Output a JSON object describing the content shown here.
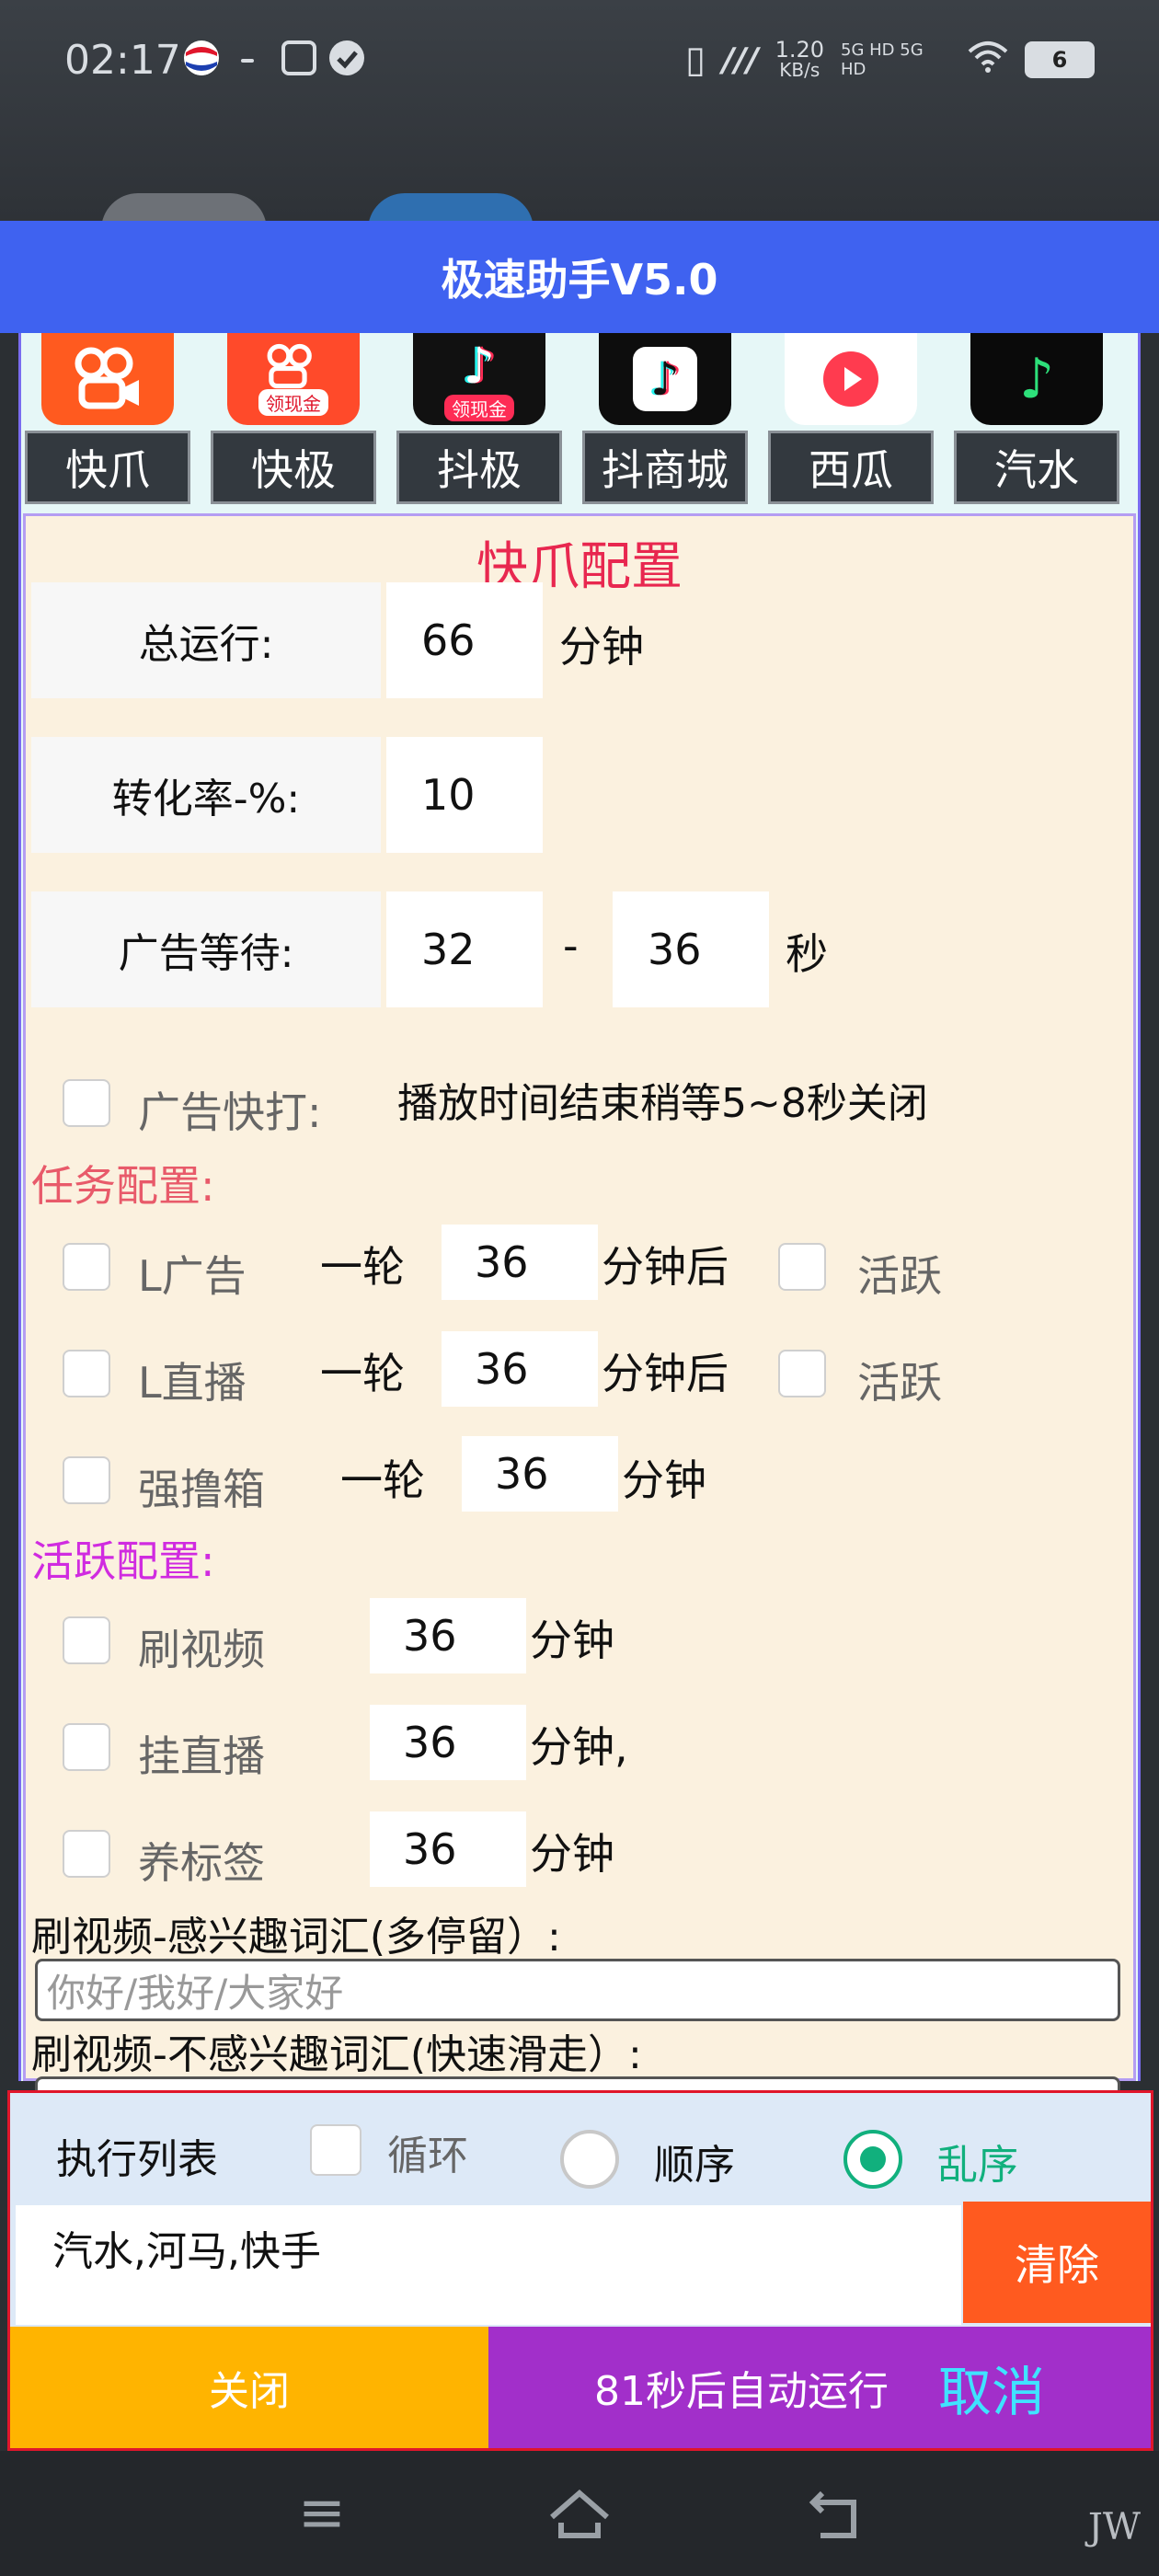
{
  "status": {
    "time": "02:17",
    "speed_value": "1.20",
    "speed_unit": "KB/s",
    "network": "5G HD 5G HD",
    "battery": "6"
  },
  "title": "极速助手V5.0",
  "apps": [
    {
      "tab": "快爪",
      "color": "#ff5a1f"
    },
    {
      "tab": "快极",
      "color": "#ff4a2a"
    },
    {
      "tab": "抖极",
      "color": "#111111"
    },
    {
      "tab": "抖商城",
      "color": "#0d0d0d"
    },
    {
      "tab": "西瓜",
      "color": "#ff3b4f"
    },
    {
      "tab": "汽水",
      "color": "#0a0a0a"
    }
  ],
  "app_badge": "领现金",
  "config": {
    "title": "快爪配置",
    "total_run": {
      "label": "总运行:",
      "value": "66",
      "unit": "分钟"
    },
    "conversion": {
      "label": "转化率-%:",
      "value": "10"
    },
    "ad_wait": {
      "label": "广告等待:",
      "min": "32",
      "dash": "-",
      "max": "36",
      "unit": "秒"
    },
    "ad_quick": {
      "label": "广告快打:",
      "note": "播放时间结束稍等5~8秒关闭"
    },
    "task_section": "任务配置:",
    "tasks": [
      {
        "label": "L广告",
        "prefix": "一轮",
        "value": "36",
        "suffix": "分钟后",
        "active": "活跃"
      },
      {
        "label": "L直播",
        "prefix": "一轮",
        "value": "36",
        "suffix": "分钟后",
        "active": "活跃"
      },
      {
        "label": "强撸箱",
        "prefix": "一轮",
        "value": "36",
        "suffix": "分钟"
      }
    ],
    "active_section": "活跃配置:",
    "actives": [
      {
        "label": "刷视频",
        "value": "36",
        "unit": "分钟"
      },
      {
        "label": "挂直播",
        "value": "36",
        "unit": "分钟,"
      },
      {
        "label": "养标签",
        "value": "36",
        "unit": "分钟"
      }
    ],
    "like_words_label": "刷视频-感兴趣词汇(多停留）:",
    "like_words_placeholder": "你好/我好/大家好",
    "dislike_words_label": "刷视频-不感兴趣词汇(快速滑走）:"
  },
  "exec": {
    "title": "执行列表",
    "loop": "循环",
    "order": "顺序",
    "random": "乱序",
    "list": "汽水,河马,快手",
    "clear": "清除",
    "close": "关闭",
    "auto_run": "81秒后自动运行",
    "cancel": "取消"
  },
  "nav": {
    "watermark": "JW"
  }
}
